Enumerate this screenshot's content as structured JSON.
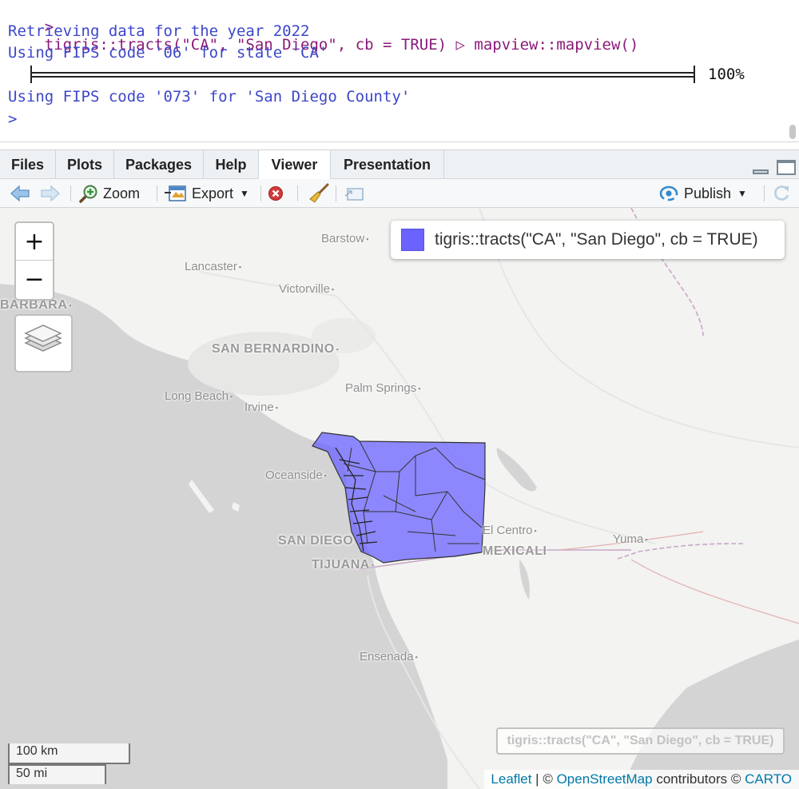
{
  "console": {
    "command_prompt": ">",
    "command": "tigris::tracts(\"CA\", \"San Diego\", cb = TRUE) ▷ mapview::mapview()",
    "line1": "Retrieving data for the year 2022",
    "line2": "Using FIPS code '06' for state 'CA'",
    "progress_value": 1.0,
    "progress_pct": "100%",
    "line3": "Using FIPS code '073' for 'San Diego County'",
    "prompt": ">"
  },
  "tabs": [
    {
      "label": "Files"
    },
    {
      "label": "Plots"
    },
    {
      "label": "Packages"
    },
    {
      "label": "Help"
    },
    {
      "label": "Viewer"
    },
    {
      "label": "Presentation"
    }
  ],
  "active_tab": "Viewer",
  "toolbar": {
    "zoom_label": "Zoom",
    "export_label": "Export",
    "publish_label": "Publish"
  },
  "map": {
    "places": {
      "barstow": "Barstow",
      "lancaster": "Lancaster",
      "victorville": "Victorville",
      "barbara": "BARBARA",
      "san_bernardino": "SAN BERNARDINO",
      "long_beach": "Long Beach",
      "irvine": "Irvine",
      "palm_springs": "Palm Springs",
      "oceanside": "Oceanside",
      "san_diego": "SAN DIEGO",
      "tijuana": "TIJUANA",
      "el_centro": "El Centro",
      "mexicali": "MEXICALI",
      "yuma": "Yuma",
      "ensenada": "Ensenada"
    },
    "zoom_in": "+",
    "zoom_out": "−",
    "legend_label": "tigris::tracts(\"CA\", \"San Diego\", cb = TRUE)",
    "layer_label": "tigris::tracts(\"CA\", \"San Diego\", cb = TRUE)",
    "scale_km": "100 km",
    "scale_mi": "50 mi",
    "attribution": {
      "leaflet": "Leaflet",
      "sep1": " | © ",
      "osm": "OpenStreetMap",
      "contrib": " contributors © ",
      "carto": "CARTO"
    },
    "colors": {
      "polygon_fill": "#6a63ff",
      "ocean": "#d4d4d4",
      "land": "#f3f3f1"
    }
  },
  "icons": {
    "back": "back-arrow-icon",
    "forward": "forward-arrow-icon",
    "zoom": "magnifier-icon",
    "export": "export-icon",
    "clear": "remove-icon",
    "broom": "broom-icon",
    "popout": "popout-icon",
    "publish": "publish-icon",
    "refresh": "refresh-icon",
    "layers": "layers-icon"
  }
}
